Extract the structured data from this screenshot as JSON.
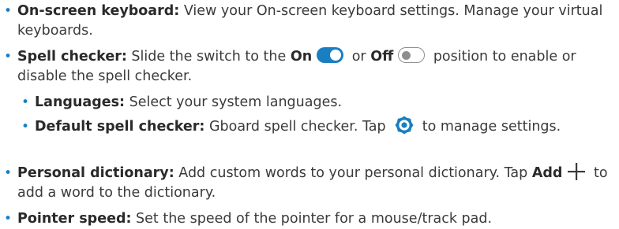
{
  "colors": {
    "accent": "#1a7fc1",
    "text": "#3a3a3a",
    "switch_off": "#8e8e8e"
  },
  "bullet_char": "•",
  "onscreen_keyboard": {
    "label": "On-screen keyboard:",
    "text": " View your On-screen keyboard settings. Manage your virtual keyboards."
  },
  "spell_checker": {
    "label": "Spell checker:",
    "text_before": " Slide the switch to the ",
    "on_label": "On",
    "or_text": " or ",
    "off_label": "Off",
    "text_after": " position to enable or disable the spell checker.",
    "on_icon": "toggle-on-icon",
    "off_icon": "toggle-off-icon"
  },
  "languages": {
    "label": "Languages:",
    "text": " Select your system languages."
  },
  "default_spell_checker": {
    "label": "Default spell checker:",
    "text_before": " Gboard spell checker. Tap ",
    "icon": "settings-gear-icon",
    "text_after": " to manage settings."
  },
  "personal_dictionary": {
    "label": "Personal dictionary:",
    "text_before": " Add custom words to your personal dictionary. Tap ",
    "add_label": "Add",
    "icon": "plus-icon",
    "text_after": " to add a word to the dictionary."
  },
  "pointer_speed": {
    "label": "Pointer speed:",
    "text": " Set the speed of the pointer for a mouse/track pad."
  }
}
